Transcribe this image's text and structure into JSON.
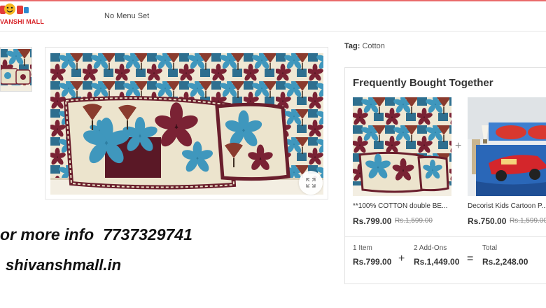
{
  "header": {
    "logo_text": "VANSHI MALL",
    "menu_text": "No Menu Set"
  },
  "promo": {
    "line1": "or more info  7737329741",
    "line2": "shivanshmall.in"
  },
  "tag": {
    "label": "Tag:",
    "value": "Cotton"
  },
  "frequently_bought": {
    "title": "Frequently Bought Together",
    "products": [
      {
        "name": "**100% COTTON double BE...",
        "price": "Rs.799.00",
        "old_price": "Rs.1,599.00"
      },
      {
        "name": "Decorist Kids Cartoon P...",
        "price": "Rs.750.00",
        "old_price": "Rs.1,599.00"
      }
    ],
    "summary": {
      "item_label": "1 Item",
      "item_value": "Rs.799.00",
      "addons_label": "2 Add-Ons",
      "addons_value": "Rs.1,449.00",
      "total_label": "Total",
      "total_value": "Rs.2,248.00"
    }
  },
  "colors": {
    "brand_red": "#d8262b",
    "fabric_cream": "#efe8d4",
    "fabric_teal": "#2e7fa3",
    "fabric_maroon": "#6a1e2c"
  }
}
